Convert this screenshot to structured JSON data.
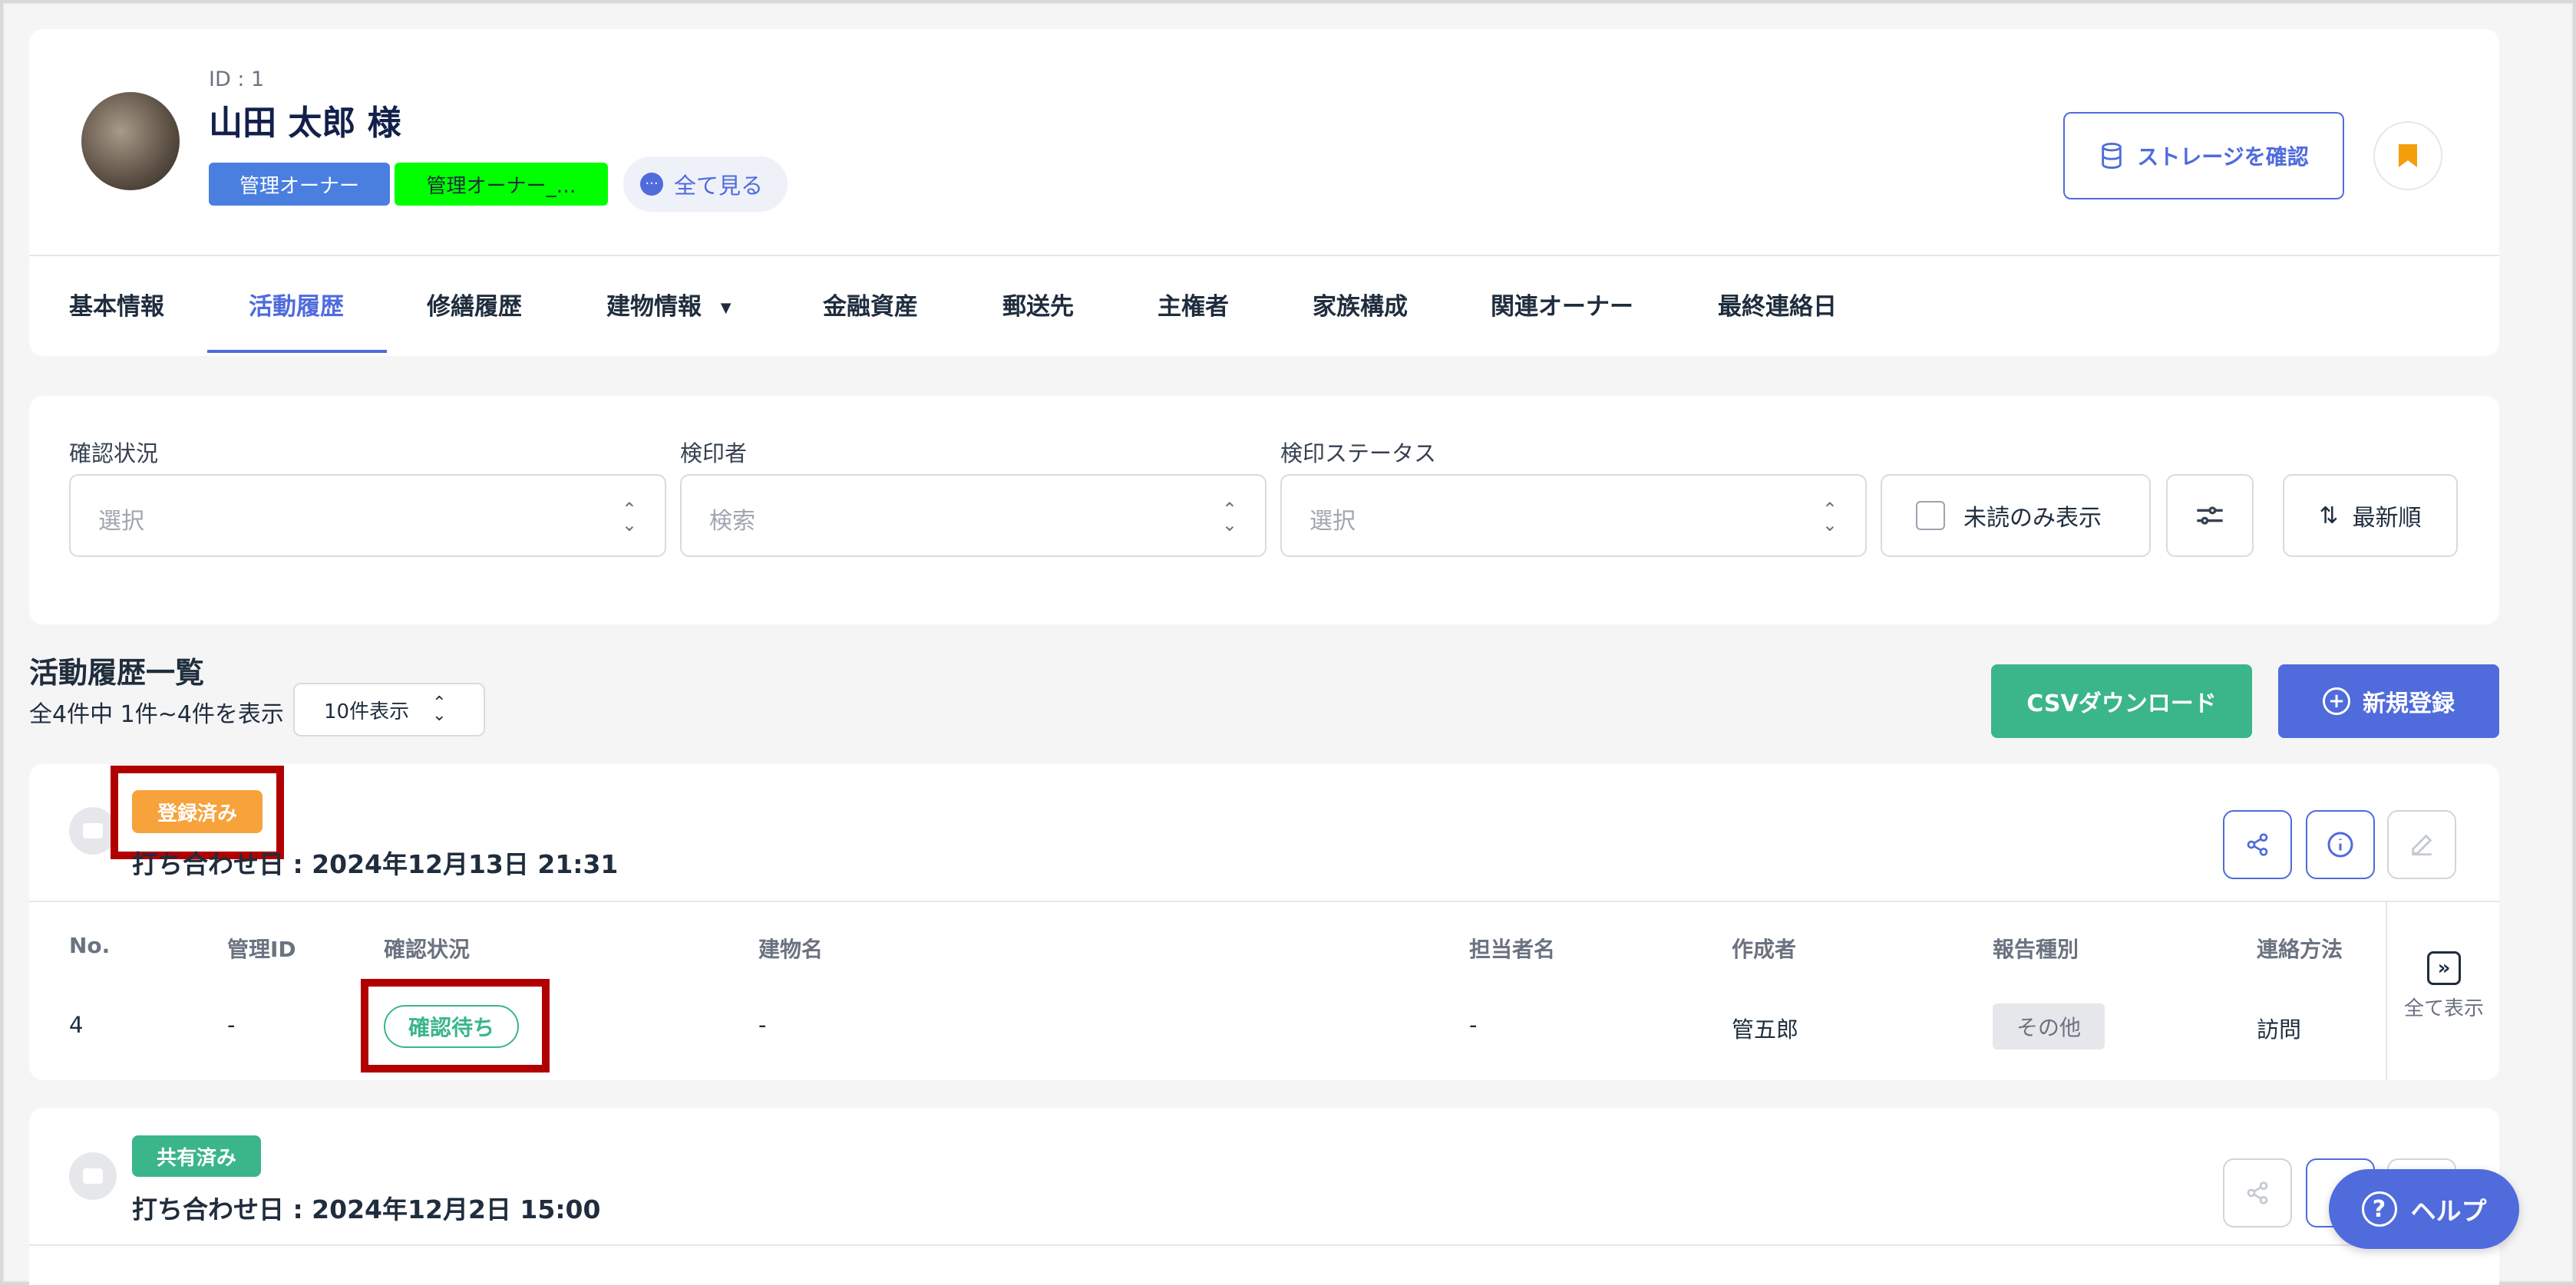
{
  "profile": {
    "id_label": "ID : 1",
    "name": "山田 太郎 様",
    "tags": [
      {
        "label": "管理オーナー",
        "color": "#4a7fe0"
      },
      {
        "label": "管理オーナー_…",
        "color": "#00ff00"
      }
    ],
    "see_all": "全て見る"
  },
  "header": {
    "storage_button": "ストレージを確認",
    "bookmark_color": "#f59e0b"
  },
  "tabs": [
    {
      "label": "基本情報"
    },
    {
      "label": "活動履歴",
      "active": true
    },
    {
      "label": "修繕履歴"
    },
    {
      "label": "建物情報"
    },
    {
      "label": "金融資産"
    },
    {
      "label": "郵送先"
    },
    {
      "label": "主権者"
    },
    {
      "label": "家族構成"
    },
    {
      "label": "関連オーナー"
    },
    {
      "label": "最終連絡日"
    }
  ],
  "filters": {
    "confirm_status": {
      "label": "確認状況",
      "placeholder": "選択"
    },
    "inspector": {
      "label": "検印者",
      "placeholder": "検索"
    },
    "inspect_status": {
      "label": "検印ステータス",
      "placeholder": "選択"
    },
    "unread_only": "未読のみ表示",
    "sort": "最新順"
  },
  "list": {
    "title": "活動履歴一覧",
    "summary": "全4件中 1件~4件を表示",
    "per_page": "10件表示",
    "csv_button": "CSVダウンロード",
    "new_button": "新規登録",
    "accent_green": "#3bb58a",
    "accent_blue": "#4f6bdc"
  },
  "entries": [
    {
      "badge": "登録済み",
      "badge_color": "#f7a23b",
      "date": "打ち合わせ日 : 2024年12月13日 21:31",
      "columns": [
        "No.",
        "管理ID",
        "確認状況",
        "建物名",
        "担当者名",
        "作成者",
        "報告種別",
        "連絡方法"
      ],
      "row": {
        "no": "4",
        "admin_id": "-",
        "status": "確認待ち",
        "building": "-",
        "person": "-",
        "creator": "管五郎",
        "report_type": "その他",
        "contact": "訪問"
      },
      "show_all": "全て表示"
    },
    {
      "badge": "共有済み",
      "badge_color": "#3bb58a",
      "date": "打ち合わせ日 : 2024年12月2日 15:00"
    }
  ],
  "help_button": "ヘルプ"
}
